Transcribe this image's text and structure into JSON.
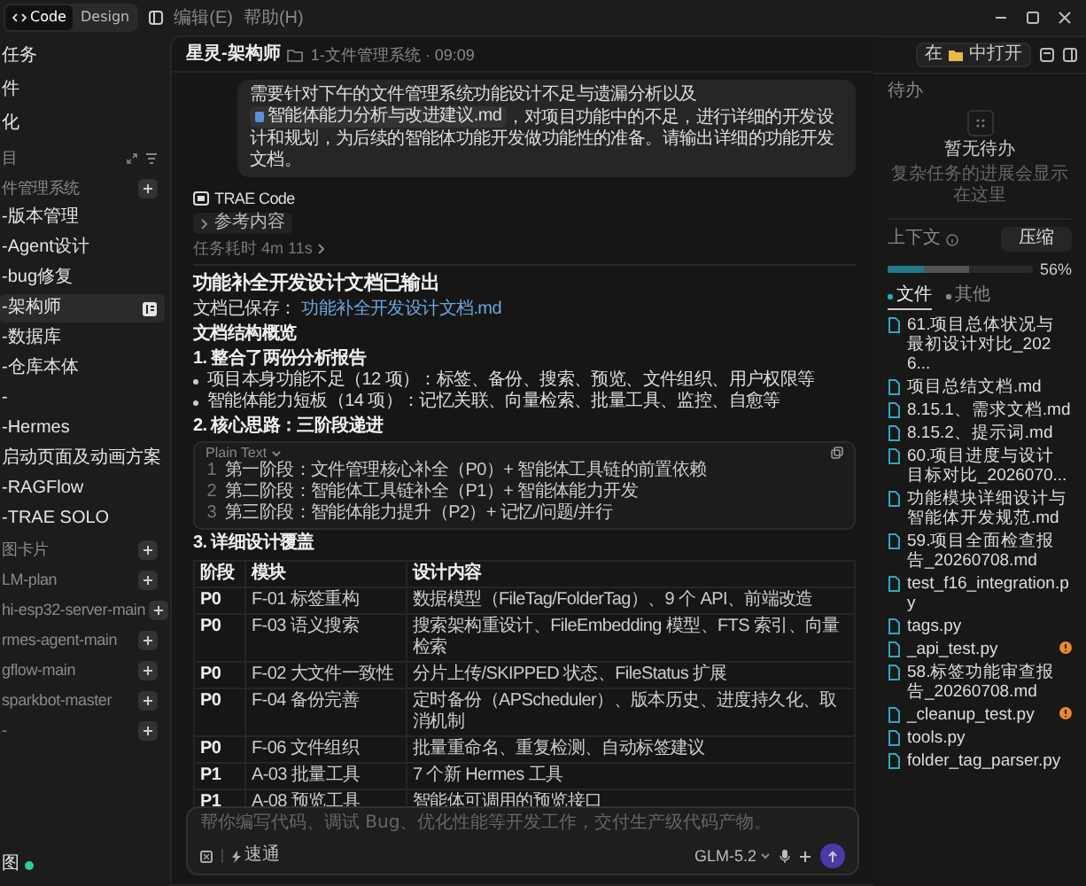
{
  "menu": {
    "modes": [
      {
        "label": "Code",
        "selected": true
      },
      {
        "label": "Design",
        "selected": false
      }
    ],
    "items": [
      "编辑(E)",
      "帮助(H)"
    ]
  },
  "sidebar": {
    "items": [
      {
        "label": "任务",
        "kind": "menu",
        "selected": false
      },
      {
        "label": "件",
        "kind": "menu",
        "selected": false
      },
      {
        "label": "化",
        "kind": "menu",
        "selected": false
      },
      {
        "label": "目",
        "kind": "section",
        "selected": false
      },
      {
        "label": "件管理系统",
        "kind": "group",
        "selected": false
      },
      {
        "label": "-版本管理",
        "kind": "chat",
        "selected": false
      },
      {
        "label": "-Agent设计",
        "kind": "chat",
        "selected": false
      },
      {
        "label": "-bug修复",
        "kind": "chat",
        "selected": false
      },
      {
        "label": "-架构师",
        "kind": "chat",
        "selected": true
      },
      {
        "label": "-数据库",
        "kind": "chat",
        "selected": false
      },
      {
        "label": "-仓库本体",
        "kind": "chat",
        "selected": false
      },
      {
        "label": "-",
        "kind": "chat",
        "selected": false
      },
      {
        "label": "-Hermes",
        "kind": "chat",
        "selected": false
      },
      {
        "label": "启动页面及动画方案",
        "kind": "chat",
        "selected": false
      },
      {
        "label": "-RAGFlow",
        "kind": "chat",
        "selected": false
      },
      {
        "label": "-TRAE SOLO",
        "kind": "chat",
        "selected": false
      },
      {
        "label": "图卡片",
        "kind": "group",
        "selected": false
      },
      {
        "label": "LM-plan",
        "kind": "group",
        "selected": false
      },
      {
        "label": "hi-esp32-server-main",
        "kind": "group",
        "selected": false
      },
      {
        "label": "rmes-agent-main",
        "kind": "group",
        "selected": false
      },
      {
        "label": "gflow-main",
        "kind": "group",
        "selected": false
      },
      {
        "label": "sparkbot-master",
        "kind": "group",
        "selected": false
      },
      {
        "label": "-",
        "kind": "group",
        "selected": false
      }
    ],
    "footer": "图"
  },
  "chat": {
    "title": "星灵-架构师",
    "subtitle": "1-文件管理系统 · 09:09",
    "user_message": {
      "before": "需要针对下午的文件管理系统功能设计不足与遗漏分析以及",
      "chip": "智能体能力分析与改进建议.md",
      "after": "，对项目功能中的不足，进行详细的开发设计和规划，为后续的智能体功能开发做功能性的准备。请输出详细的功能开发文档。"
    },
    "assistant": {
      "name": "TRAE Code",
      "references": "参考内容",
      "duration": "任务耗时 4m 11s",
      "title": "功能补全开发设计文档已输出",
      "saved_label": "文档已保存：",
      "saved_link": "功能补全开发设计文档.md",
      "blocks": [
        {
          "kind": "heading",
          "text": "文档结构概览"
        },
        {
          "kind": "subheading",
          "text": "1. 整合了两份分析报告"
        },
        {
          "kind": "bullets",
          "items": [
            "项目本身功能不足（12 项）：标签、备份、搜索、预览、文件组织、用户权限等",
            "智能体能力短板（14 项）：记忆关联、向量检索、批量工具、监控、自愈等"
          ]
        },
        {
          "kind": "subheading",
          "text": "2. 核心思路：三阶段递进"
        },
        {
          "kind": "code",
          "language": "Plain Text",
          "lines": [
            {
              "number": "1",
              "text": "第一阶段：文件管理核心补全（P0）+ 智能体工具链的前置依赖"
            },
            {
              "number": "2",
              "text": "第二阶段：智能体工具链补全（P1）+ 智能体能力开发"
            },
            {
              "number": "3",
              "text": "第三阶段：智能体能力提升（P2）+ 记忆/问题/并行"
            }
          ]
        },
        {
          "kind": "subheading",
          "text": "3. 详细设计覆盖"
        },
        {
          "kind": "table",
          "columns": [
            "阶段",
            "模块",
            "设计内容"
          ],
          "rows": [
            [
              "P0",
              "F-01 标签重构",
              "数据模型（FileTag/FolderTag）、9 个 API、前端改造"
            ],
            [
              "P0",
              "F-03 语义搜索",
              "搜索架构重设计、FileEmbedding 模型、FTS 索引、向量检索"
            ],
            [
              "P0",
              "F-02 大文件一致性",
              "分片上传/SKIPPED 状态、FileStatus 扩展"
            ],
            [
              "P0",
              "F-04 备份完善",
              "定时备份（APScheduler）、版本历史、进度持久化、取消机制"
            ],
            [
              "P0",
              "F-06 文件组织",
              "批量重命名、重复检测、自动标签建议"
            ],
            [
              "P1",
              "A-03 批量工具",
              "7 个新 Hermes 工具"
            ],
            [
              "P1",
              "A-08 预览工具",
              "智能体可调用的预览接口"
            ]
          ]
        }
      ]
    },
    "input": {
      "placeholder": "帮你编写代码、调试 Bug、优化性能等开发工作，交付生产级代码产物。",
      "mode": "速通",
      "model": "GLM-5.2"
    }
  },
  "right": {
    "open_before": "在",
    "open_after": "中打开",
    "todo": {
      "title": "待办",
      "empty": "暂无待办",
      "hint": "复杂任务的进展会显示在这里"
    },
    "context": {
      "title": "上下文",
      "compress": "压缩",
      "level": 0.56,
      "percent": "56%"
    },
    "tabs": [
      {
        "label": "文件",
        "selected": true
      },
      {
        "label": "其他",
        "selected": false
      }
    ],
    "files": [
      {
        "name": "61.项目总体状况与最初设计对比_2026...",
        "warning": false
      },
      {
        "name": "项目总结文档.md",
        "warning": false
      },
      {
        "name": "8.15.1、需求文档.md",
        "warning": false
      },
      {
        "name": "8.15.2、提示词.md",
        "warning": false
      },
      {
        "name": "60.项目进度与设计目标对比_2026070...",
        "warning": false
      },
      {
        "name": "功能模块详细设计与智能体开发规范.md",
        "warning": false
      },
      {
        "name": "59.项目全面检查报告_20260708.md",
        "warning": false
      },
      {
        "name": "test_f16_integration.py",
        "warning": false
      },
      {
        "name": "tags.py",
        "warning": false
      },
      {
        "name": "_api_test.py",
        "warning": true
      },
      {
        "name": "58.标签功能审查报告_20260708.md",
        "warning": false
      },
      {
        "name": "_cleanup_test.py",
        "warning": true
      },
      {
        "name": "tools.py",
        "warning": false
      },
      {
        "name": "folder_tag_parser.py",
        "warning": false
      }
    ]
  }
}
